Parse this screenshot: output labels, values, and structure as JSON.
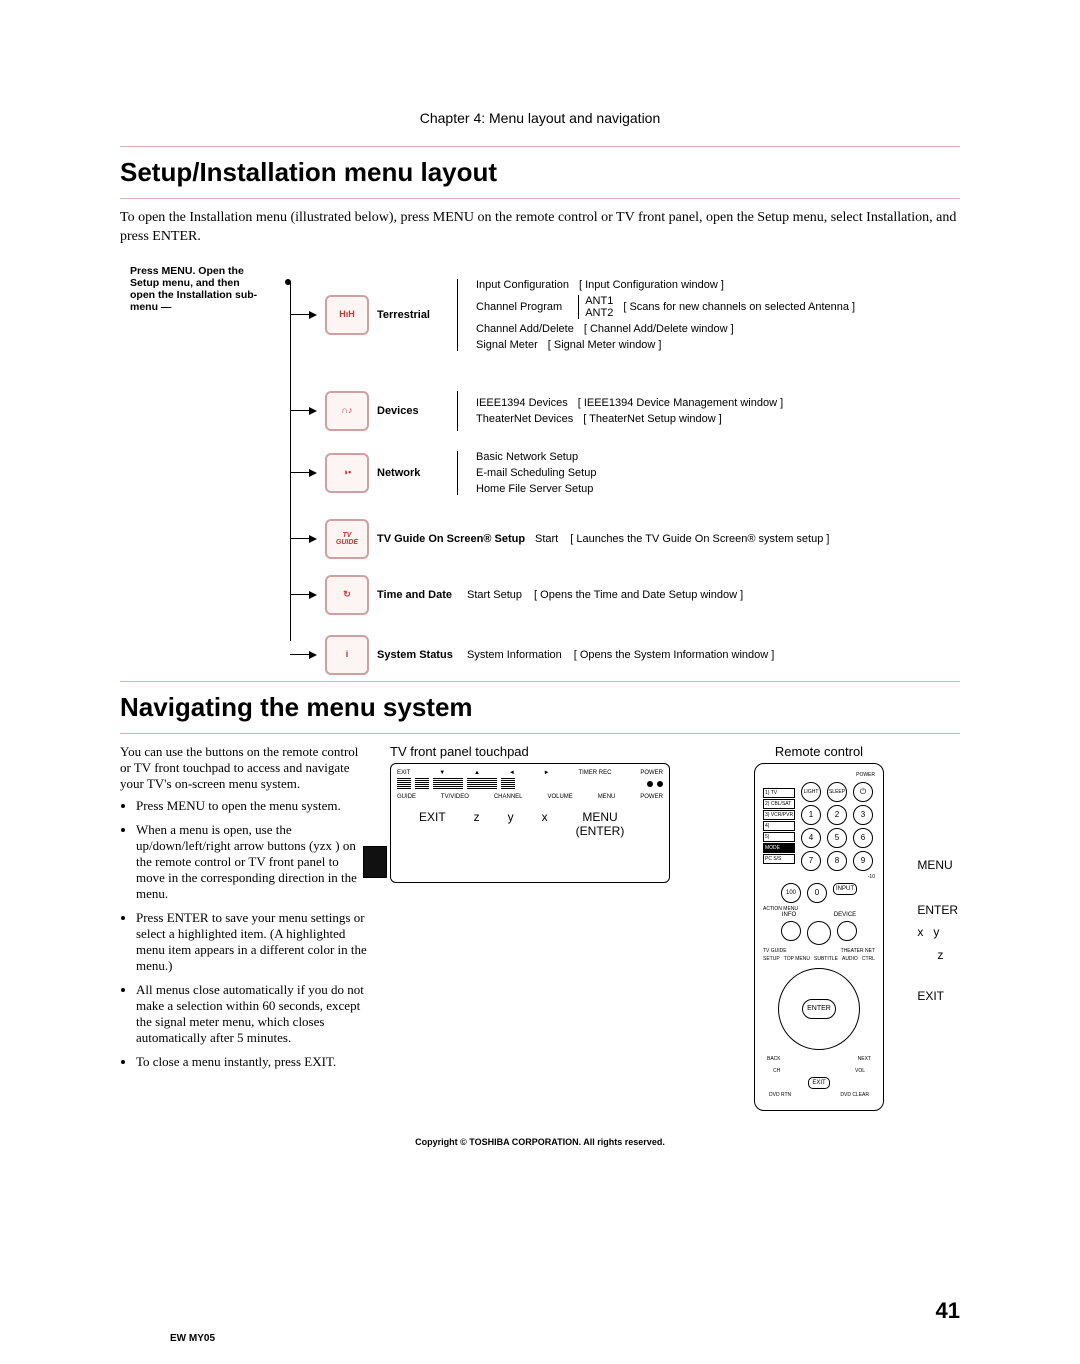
{
  "chapter": "Chapter 4: Menu layout and navigation",
  "section1_title": "Setup/Installation menu layout",
  "intro": "To open the Installation menu (illustrated below), press MENU on the remote control or TV front panel, open the Setup menu, select Installation, and press ENTER.",
  "tree_hint": "Press MENU. Open the Setup menu, and then open the Installation sub-menu —",
  "rows": {
    "terrestrial": {
      "cat": "Terrestrial",
      "items": [
        {
          "label": "Input Configuration",
          "desc": "[ Input Configuration window ]"
        },
        {
          "label": "Channel Program",
          "sub": [
            "ANT1",
            "ANT2"
          ],
          "subdesc": "[ Scans for new channels on selected Antenna ]"
        },
        {
          "label": "Channel Add/Delete",
          "desc": "[ Channel Add/Delete window ]"
        },
        {
          "label": "Signal Meter",
          "desc": "[ Signal Meter window ]"
        }
      ]
    },
    "devices": {
      "cat": "Devices",
      "items": [
        {
          "label": "IEEE1394 Devices",
          "desc": "[ IEEE1394 Device Management window ]"
        },
        {
          "label": "TheaterNet Devices",
          "desc": "[ TheaterNet Setup window ]"
        }
      ]
    },
    "network": {
      "cat": "Network",
      "items": [
        {
          "label": "Basic Network Setup"
        },
        {
          "label": "E-mail Scheduling Setup"
        },
        {
          "label": "Home File Server Setup"
        }
      ]
    },
    "tvguide": {
      "cat": "TV Guide On Screen® Setup",
      "start": "Start",
      "desc": "[ Launches the TV Guide On Screen® system setup ]"
    },
    "timedate": {
      "cat": "Time and Date",
      "start": "Start Setup",
      "desc": "[ Opens the Time and Date Setup window ]"
    },
    "status": {
      "cat": "System Status",
      "start": "System Information",
      "desc": "[ Opens the System Information window ]"
    }
  },
  "section2_title": "Navigating the menu system",
  "nav_intro": "You can use the buttons on the remote control or TV front touchpad to access and navigate your TV's on-screen menu system.",
  "bullets": [
    "Press MENU to open the menu system.",
    "When a menu is open, use the up/down/left/right arrow buttons (yzx ) on the remote control or TV front panel to move in the corresponding direction in the menu.",
    "Press ENTER to save your menu settings or select a highlighted item. (A highlighted menu item appears in a different color in the menu.)",
    "All menus close automatically if you do not make a selection within 60 seconds, except the signal meter menu, which closes automatically after 5 minutes.",
    "To close a menu instantly, press EXIT."
  ],
  "tvpanel_title": "TV front panel touchpad",
  "tvpanel_top": [
    "EXIT",
    "▼",
    "▲",
    "◄",
    "►",
    "TIMER REC",
    "POWER"
  ],
  "tvpanel_labels": [
    "GUIDE",
    "TV/VIDEO",
    "CHANNEL",
    "VOLUME",
    "MENU",
    "POWER"
  ],
  "tvpanel_guide": {
    "exit": "EXIT",
    "z": "z",
    "y": "y",
    "x": "x",
    "menu": "MENU",
    "enter": "(ENTER)"
  },
  "remote_title": "Remote control",
  "remote_side": [
    "1) TV",
    "2) CBL/SAT",
    "3) VCR/PVR",
    "4)",
    "5)",
    "MODE",
    "PC S/S"
  ],
  "remote_top": [
    "LIGHT",
    "SLEEP",
    "⏻"
  ],
  "remote_top_label": "POWER",
  "remote_nums": [
    "1",
    "2",
    "3",
    "4",
    "5",
    "6",
    "7",
    "8",
    "9",
    "100",
    "0",
    "INPUT"
  ],
  "remote_action": "ACTION MENU",
  "remote_info": [
    "INFO",
    "DEVICE"
  ],
  "remote_ring": [
    "TV GUIDE",
    "THEATER NET",
    "SETUP",
    "TOP MENU",
    "SUBTITLE",
    "AUDIO",
    "CTRL"
  ],
  "remote_nav": [
    "BACK",
    "ENTER",
    "NEXT"
  ],
  "remote_low": [
    "CH",
    "VOL",
    "EXIT",
    "DVD RTN",
    "DVD CLEAR"
  ],
  "remote_minus10": "-10",
  "callouts": {
    "menu": "MENU",
    "enter": "ENTER",
    "y": "y",
    "x": "x",
    "z": "z",
    "exit": "EXIT"
  },
  "copyright": "Copyright © TOSHIBA CORPORATION. All rights reserved.",
  "page_number": "41",
  "foot": "EW MY05"
}
